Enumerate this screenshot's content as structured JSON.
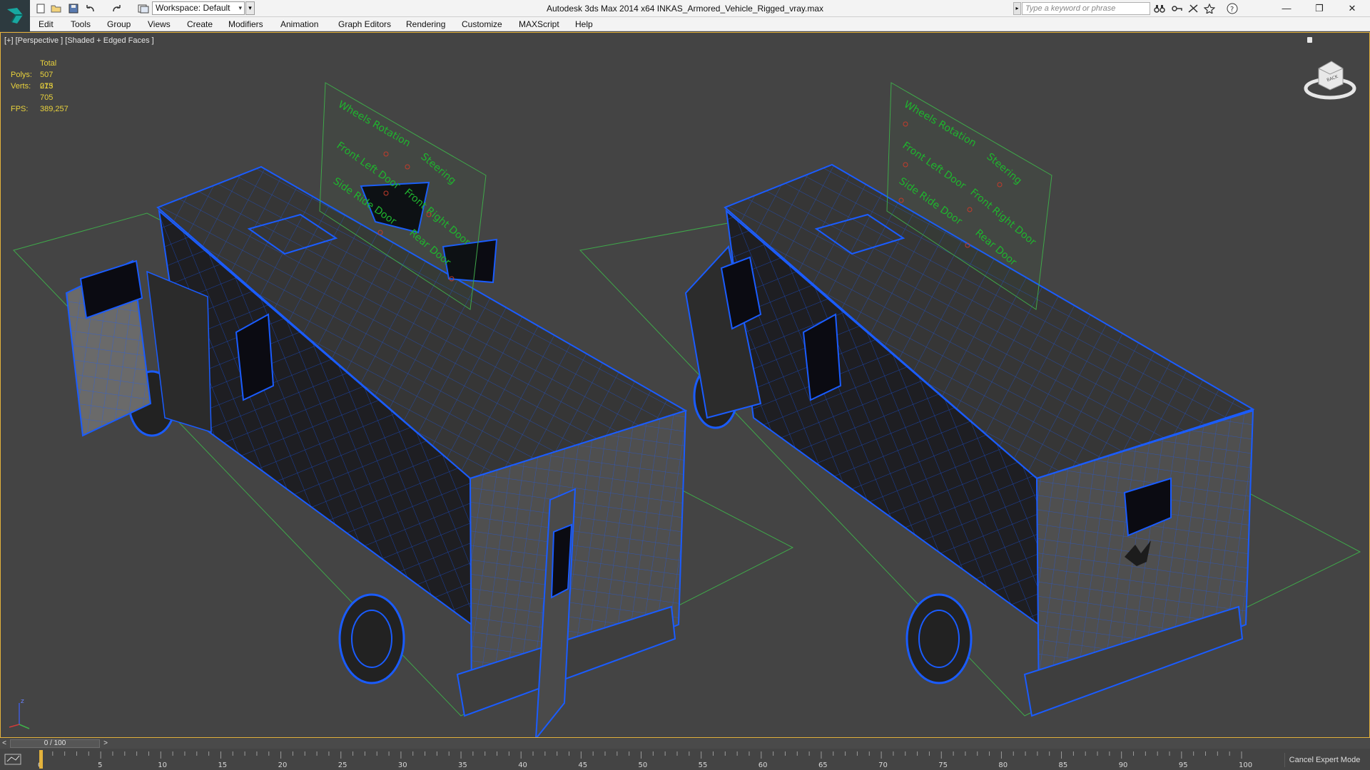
{
  "window": {
    "title": "Autodesk 3ds Max  2014 x64     INKAS_Armored_Vehicle_Rigged_vray.max",
    "workspace": "Workspace: Default",
    "search_placeholder": "Type a keyword or phrase",
    "minimize": "—",
    "maximize": "❐",
    "close": "✕"
  },
  "quick_access_icons": [
    "new-file-icon",
    "open-file-icon",
    "save-icon",
    "undo-icon",
    "redo-icon",
    "project-folder-icon"
  ],
  "info_icons": [
    "binoculars-icon",
    "key-icon",
    "subscription-icon",
    "favorites-star-icon",
    "help-icon"
  ],
  "menu": [
    "Edit",
    "Tools",
    "Group",
    "Views",
    "Create",
    "Modifiers",
    "Animation",
    "Graph Editors",
    "Rendering",
    "Customize",
    "MAXScript",
    "Help"
  ],
  "viewport": {
    "label": "[+] [Perspective ] [Shaded + Edged Faces ]",
    "stats": {
      "header": "Total",
      "polys_label": "Polys:",
      "polys_value": "507 013",
      "verts_label": "Verts:",
      "verts_value": "275 705",
      "fps_label": "FPS:",
      "fps_value": "389,257"
    },
    "viewcube_face": "BACK",
    "axis_z": "z"
  },
  "rig_panels": [
    {
      "labels": [
        "Wheels Rotation",
        "Steering",
        "Front Left Door",
        "Front Right Door",
        "Side Ride Door",
        "Rear Door"
      ]
    },
    {
      "labels": [
        "Wheels Rotation",
        "Steering",
        "Front Left Door",
        "Front Right Door",
        "Side Ride Door",
        "Rear Door"
      ]
    }
  ],
  "timeline": {
    "slider_text": "0 / 100",
    "slider_left": "<",
    "slider_right": ">",
    "ticks": [
      "0",
      "5",
      "10",
      "15",
      "20",
      "25",
      "30",
      "35",
      "40",
      "45",
      "50",
      "55",
      "60",
      "65",
      "70",
      "75",
      "80",
      "85",
      "90",
      "95",
      "100"
    ],
    "cancel_expert": "Cancel Expert Mode"
  },
  "colors": {
    "viewport_bg": "#444444",
    "wire": "#1a5cff",
    "stats": "#e9d23c",
    "rig_text": "#1fb52e",
    "active_border": "#e3b23c"
  }
}
